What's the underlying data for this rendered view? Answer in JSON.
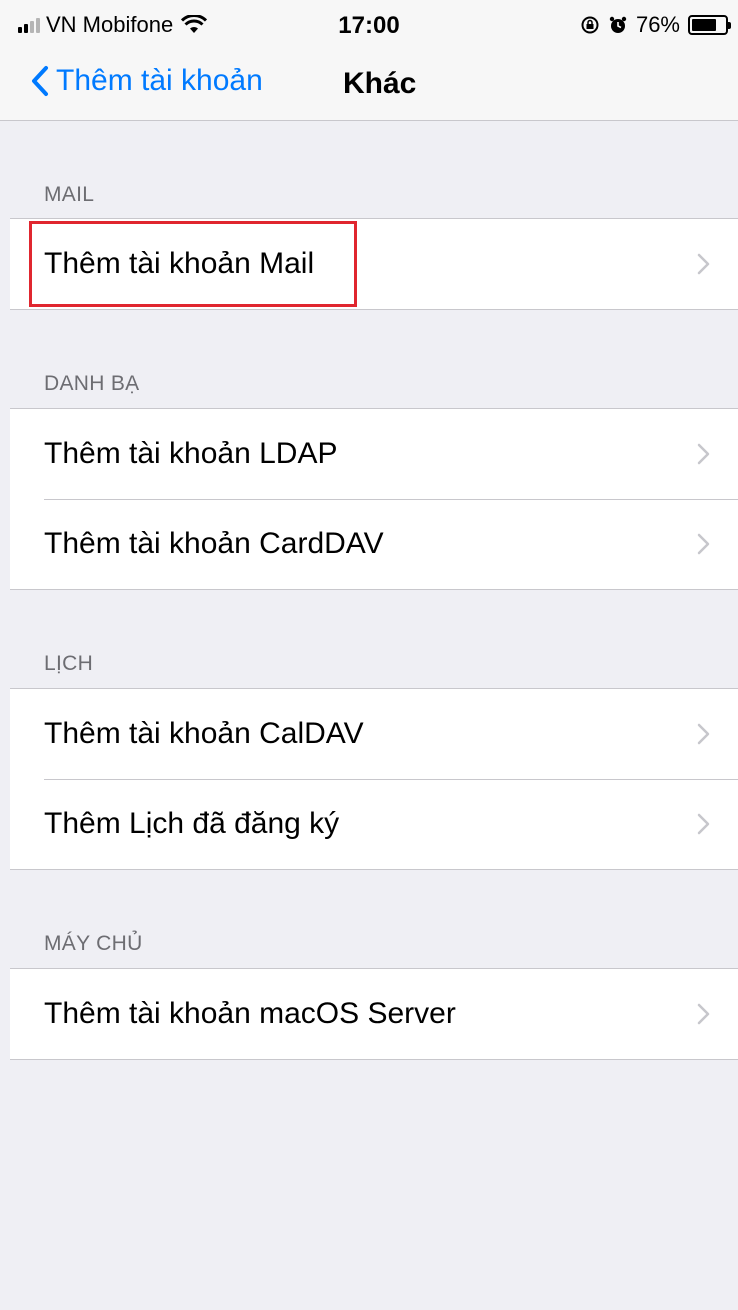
{
  "status_bar": {
    "carrier": "VN Mobifone",
    "time": "17:00",
    "battery": "76%",
    "battery_level": 0.76,
    "icons": [
      "signal-icon",
      "wifi-icon",
      "rotation-lock-icon",
      "alarm-icon",
      "battery-icon"
    ]
  },
  "nav": {
    "back_label": "Thêm tài khoản",
    "title": "Khác"
  },
  "sections": [
    {
      "header": "MAIL",
      "items": [
        "Thêm tài khoản Mail"
      ]
    },
    {
      "header": "DANH BẠ",
      "items": [
        "Thêm tài khoản LDAP",
        "Thêm tài khoản CardDAV"
      ]
    },
    {
      "header": "LỊCH",
      "items": [
        "Thêm tài khoản CalDAV",
        "Thêm Lịch đã đăng ký"
      ]
    },
    {
      "header": "MÁY CHỦ",
      "items": [
        "Thêm tài khoản macOS Server"
      ]
    }
  ],
  "colors": {
    "accent": "#007aff",
    "highlight": "#e0262f",
    "background": "#efeff4"
  }
}
